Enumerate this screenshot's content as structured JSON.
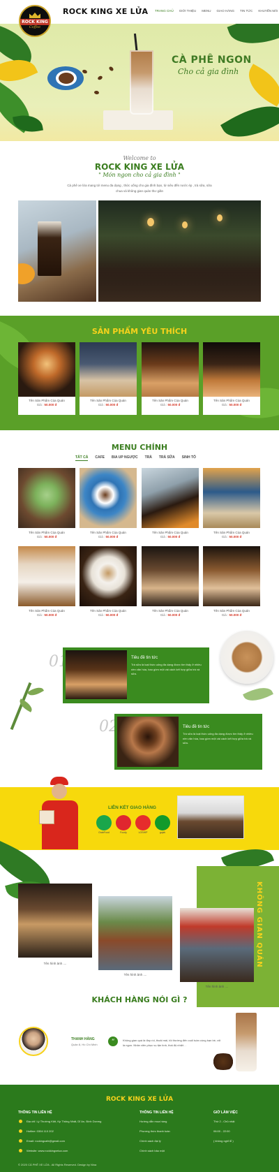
{
  "header": {
    "logo_text": "ROCK KING",
    "logo_sub": "Coffee",
    "title": "ROCK KING XE LỬA",
    "nav": [
      "TRANG CHỦ",
      "GIỚI THIỆU",
      "MENU",
      "GIAO HÀNG",
      "TIN TỨC",
      "KHUYẾN MÃI"
    ]
  },
  "hero": {
    "heading": "CÀ PHÊ NGON",
    "subheading": "Cho cả gia đình"
  },
  "welcome": {
    "script": "Welcome to",
    "title": "ROCK KING XE LỬA",
    "slogan": "\" Món ngon cho cả gia đình \"",
    "description": "Cà phê xe lửa mang tới menu đa dạng , thức uống cho gia đình bạn, từ siêu đến nước ép , trà sữa, sữa chua và không gian quán thư giãn"
  },
  "favorites": {
    "title": "SẢN PHẨM YÊU THÍCH",
    "items": [
      {
        "name": "Tên Sản Phẩm Của Quán",
        "price_label": "Giá :",
        "price": "50.000 đ"
      },
      {
        "name": "Tên Sản Phẩm Của Quán",
        "price_label": "Giá :",
        "price": "50.000 đ"
      },
      {
        "name": "Tên Sản Phẩm Của Quán",
        "price_label": "Giá :",
        "price": "50.000 đ"
      },
      {
        "name": "Tên Sản Phẩm Của Quán",
        "price_label": "Giá :",
        "price": "50.000 đ"
      }
    ]
  },
  "menu": {
    "title": "MENU CHÍNH",
    "tabs": [
      "TẤT CẢ",
      "CAFE",
      "BIA UP NGƯỢC",
      "TRÀ",
      "TRÀ SỮA",
      "SINH TỐ"
    ],
    "items": [
      {
        "name": "Tên Sản Phẩm Của Quán",
        "price_label": "Giá :",
        "price": "50.000 đ"
      },
      {
        "name": "Tên Sản Phẩm Của Quán",
        "price_label": "Giá :",
        "price": "50.000 đ"
      },
      {
        "name": "Tên Sản Phẩm Của Quán",
        "price_label": "Giá :",
        "price": "50.000 đ"
      },
      {
        "name": "Tên Sản Phẩm Của Quán",
        "price_label": "Giá :",
        "price": "50.000 đ"
      },
      {
        "name": "Tên Sản Phẩm Của Quán",
        "price_label": "Giá :",
        "price": "50.000 đ"
      },
      {
        "name": "Tên Sản Phẩm Của Quán",
        "price_label": "Giá :",
        "price": "50.000 đ"
      },
      {
        "name": "Tên Sản Phẩm Của Quán",
        "price_label": "Giá :",
        "price": "50.000 đ"
      },
      {
        "name": "Tên Sản Phẩm Của Quán",
        "price_label": "Giá :",
        "price": "50.000 đ"
      }
    ]
  },
  "news": [
    {
      "num": "01",
      "title": "Tiêu đề tin tức",
      "desc": "Trà sữa là loại thức uống đa dạng được tìm thấy ở nhiều nền văn hóa, bao gồm một vài cách kết hợp giữa trà và sữa."
    },
    {
      "num": "02",
      "title": "Tiêu đề tin tức",
      "desc": "Trà sữa là loại thức uống đa dạng được tìm thấy ở nhiều nền văn hóa, bao gồm một vài cách kết hợp giữa trà và sữa."
    }
  ],
  "delivery": {
    "title": "LIÊN KẾT GIAO HÀNG",
    "apps": [
      {
        "name": "GrabFood",
        "color": "#1aa64b"
      },
      {
        "name": "Foody",
        "color": "#e0262f"
      },
      {
        "name": "LOSHIP",
        "color": "#e62c2c"
      },
      {
        "name": "gojek",
        "color": "#129a2b"
      }
    ]
  },
  "space": {
    "title": "KHÔNG GIAN QUÁN",
    "captions": [
      "Tên hình ảnh ....",
      "Tên hình ảnh ....",
      "Tên hình ảnh ...."
    ]
  },
  "customers": {
    "title": "KHÁCH HÀNG NÓI GÌ ?",
    "name": "THANH HẰNG",
    "location": "Quận 8, Hồ Chí Minh",
    "quote": "Không gian quá là đẹp rồi, thoải mái, tôi thường đến cuối tuần cùng bạn bè, rất là ngon. Nhân viên phục vụ tận tình, thái độ nhiệt . ."
  },
  "footer": {
    "title": "ROCK KING XE LỬA",
    "col1_title": "THÔNG TIN LIÊN HỆ",
    "col1_lines": [
      "Địa chỉ: Lý Thường Kiệt, Kp Thống Nhất, Dĩ An, Bình Dương",
      "Hotline: 0304 110 202",
      "Email: rockingcafe@gmail.com",
      "Website: www.rockkingxelua.com"
    ],
    "col2_title": "THÔNG TIN LIÊN HỆ",
    "col2_lines": [
      "Hướng dẫn mua hàng",
      "Phương thức thanh toán",
      "Chính sách đại lý",
      "Chính sách bảo mật"
    ],
    "col3_title": "GIỜ LÀM VIỆC",
    "col3_lines": [
      "Thứ 2 - Chủ nhật",
      "06:00 - 22:00",
      "( không nghỉ lễ )"
    ],
    "copyright": "© 2020 CÀ PHÊ XE LỬA . All Rights Reserved. Design by Nina"
  }
}
